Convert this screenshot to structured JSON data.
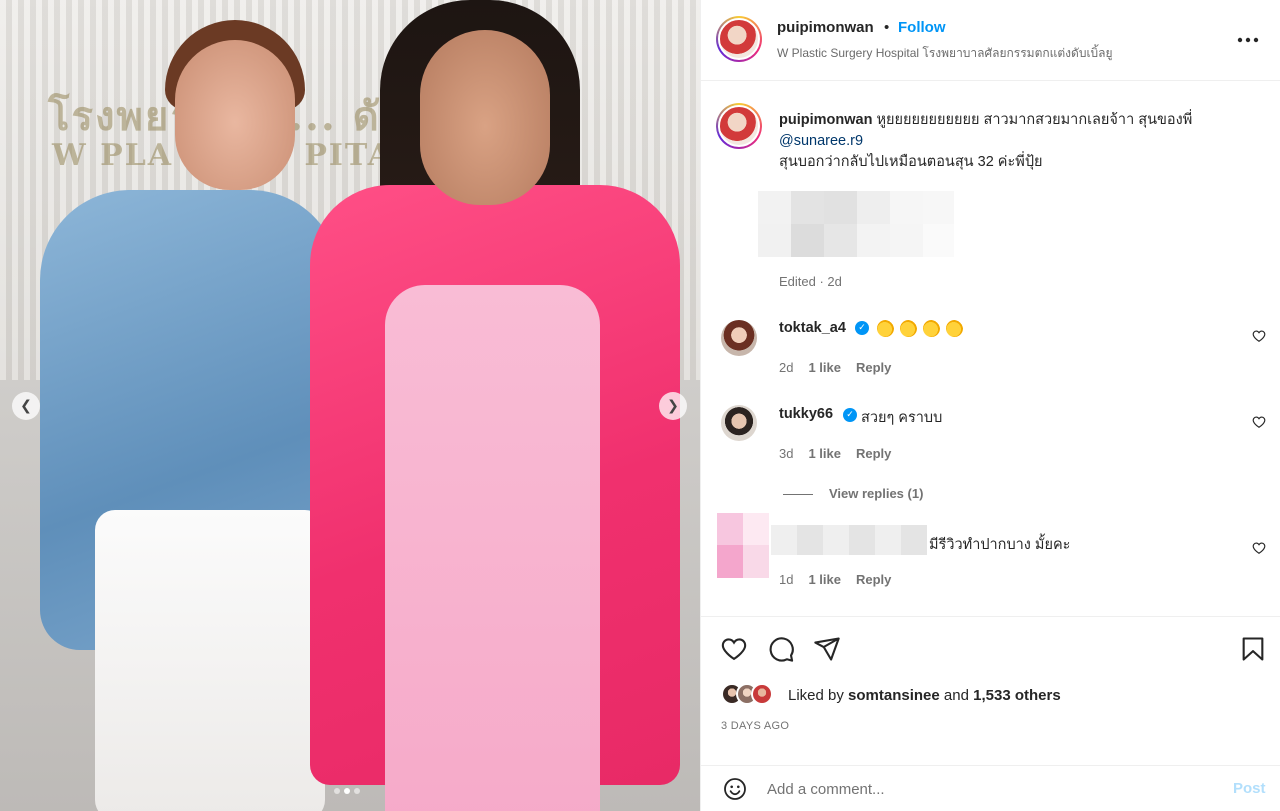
{
  "post": {
    "username": "puipimonwan",
    "separator": "•",
    "follow_label": "Follow",
    "location": "W Plastic Surgery Hospital โรงพยาบาลศัลยกรรมตกแต่งดับเบิ้ลยู",
    "more_icon": "more-horizontal-icon",
    "photo_sign_line1": "โรงพยาบาล ... ดับเบิ้ลยู",
    "photo_sign_line2": "W PLA  SURG  PITAL",
    "carousel_pages": 3,
    "carousel_active": 1
  },
  "caption": {
    "username": "puipimonwan",
    "text": "หูยยยยยยยยยยย สาวมากสวยมากเลยจ้าา สุนของพี่",
    "mention": "@sunaree.r9",
    "text2": "สุนบอกว่ากลับไปเหมือนตอนสุน 32 ค่ะพี่ปุ้ย",
    "edited": "Edited · 2d"
  },
  "comments": [
    {
      "user": "toktak_a4",
      "verified": true,
      "text": "",
      "emoji": "clapping-hands",
      "emoji_count": 4,
      "age": "2d",
      "likes": "1 like",
      "reply": "Reply"
    },
    {
      "user": "tukky66",
      "verified": true,
      "text": "สวยๆ คราบบ",
      "age": "3d",
      "likes": "1 like",
      "reply": "Reply",
      "view_replies": "View replies (1)"
    },
    {
      "user": "",
      "verified": false,
      "text": "มีรีวิวทำปากบาง มั้ยคะ",
      "age": "1d",
      "likes": "1 like",
      "reply": "Reply"
    }
  ],
  "actions": {
    "like_icon": "heart-icon",
    "comment_icon": "comment-icon",
    "share_icon": "send-icon",
    "save_icon": "bookmark-icon",
    "liked_prefix": "Liked by",
    "liked_user": "somtansinee",
    "liked_and": "and",
    "liked_others": "1,533 others",
    "time_ago": "3 DAYS AGO"
  },
  "composer": {
    "emoji_icon": "smiley-icon",
    "placeholder": "Add a comment...",
    "post_label": "Post",
    "post_color": "#b2dffc"
  },
  "colors": {
    "accent": "#0095f6",
    "mention": "#00376b",
    "muted": "#737373"
  }
}
